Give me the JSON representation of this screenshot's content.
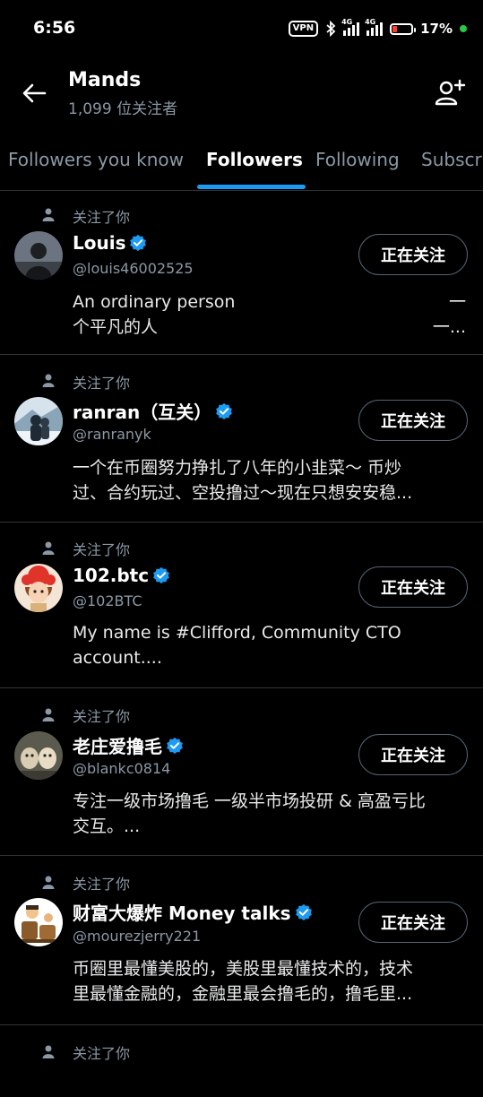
{
  "status": {
    "time": "6:56",
    "vpn": "VPN",
    "net1": "4G",
    "net2": "4G",
    "battery": "17%"
  },
  "header": {
    "title": "Mands",
    "subtitle": "1,099 位关注者"
  },
  "tabs": [
    "Followers you know",
    "Followers",
    "Following",
    "Subscr"
  ],
  "follows_you_label": "关注了你",
  "following_label": "正在关注",
  "users": [
    {
      "name": "Louis",
      "handle": "@louis46002525",
      "bio1": "An ordinary person",
      "bio2": "个平凡的人",
      "bio1r": "一",
      "bio2r": "一..."
    },
    {
      "name": "ranran（互关）",
      "handle": "@ranranyk",
      "bio1": "一个在币圈努力挣扎了八年的小韭菜～ 币炒",
      "bio2": "过、合约玩过、空投撸过～现在只想安安稳..."
    },
    {
      "name": "102.btc",
      "handle": "@102BTC",
      "bio1": "My name is #Clifford, Community CTO",
      "bio2": "account...."
    },
    {
      "name": "老庄爱撸毛",
      "handle": "@blankc0814",
      "bio1": "专注一级市场撸毛 一级半市场投研 & 高盈亏比",
      "bio2": "交互。..."
    },
    {
      "name": "财富大爆炸 Money talks",
      "handle": "@mourezjerry221",
      "bio1": "币圈里最懂美股的，美股里最懂技术的，技术",
      "bio2": "里最懂金融的，金融里最会撸毛的，撸毛里..."
    }
  ]
}
